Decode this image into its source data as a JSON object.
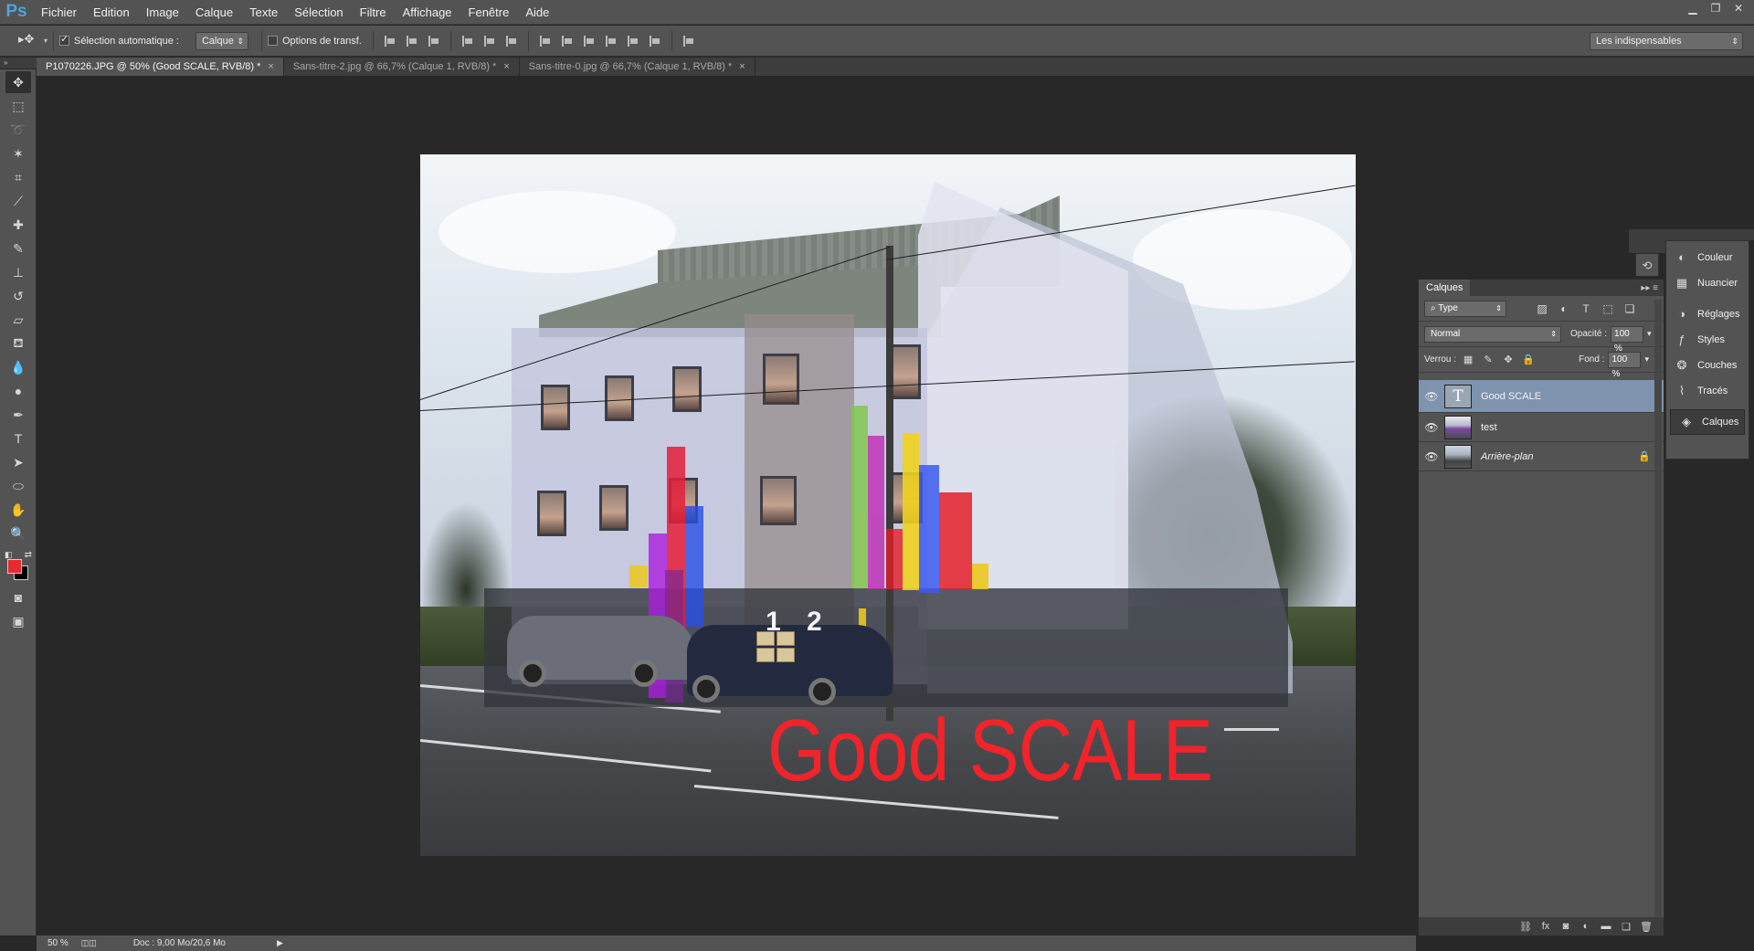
{
  "app": {
    "logo": "Ps"
  },
  "menu": [
    "Fichier",
    "Edition",
    "Image",
    "Calque",
    "Texte",
    "Sélection",
    "Filtre",
    "Affichage",
    "Fenêtre",
    "Aide"
  ],
  "window_controls": {
    "minimize": "▁",
    "restore": "❐",
    "close": "✕"
  },
  "options": {
    "auto_select_label": "Sélection automatique :",
    "auto_select_checked": true,
    "auto_select_target": "Calque",
    "transform_label": "Options de transf.",
    "transform_checked": false,
    "workspace": "Les indispensables"
  },
  "tabs": [
    {
      "label": "P1070226.JPG @ 50% (Good SCALE, RVB/8) *",
      "active": true
    },
    {
      "label": "Sans-titre-2.jpg @ 66,7% (Calque 1, RVB/8) *",
      "active": false
    },
    {
      "label": "Sans-titre-0.jpg @ 66,7% (Calque 1, RVB/8) *",
      "active": false
    }
  ],
  "tab_close": "×",
  "colors": {
    "foreground": "#e52b2b",
    "background": "#000000",
    "accent_selected_layer": "#7e93ad",
    "overlay_text": "#f0242a"
  },
  "canvas": {
    "overlay_text": "Good SCALE",
    "house_numbers": "1 2"
  },
  "status": {
    "zoom": "50 %",
    "doc": "Doc : 9,00 Mo/20,6 Mo"
  },
  "right_dock": {
    "items": [
      {
        "label": "Couleur",
        "icon": "color-wheel-icon",
        "glyph": "◐"
      },
      {
        "label": "Nuancier",
        "icon": "swatches-grid-icon",
        "glyph": "▦"
      },
      {
        "label": "Réglages",
        "icon": "adjustments-icon",
        "glyph": "◑"
      },
      {
        "label": "Styles",
        "icon": "fx-styles-icon",
        "glyph": "ƒ"
      },
      {
        "label": "Couches",
        "icon": "channels-icon",
        "glyph": "❂"
      },
      {
        "label": "Tracés",
        "icon": "paths-icon",
        "glyph": "⌇"
      },
      {
        "label": "Calques",
        "icon": "layers-icon",
        "glyph": "◈"
      }
    ]
  },
  "layers_panel": {
    "title": "Calques",
    "filter_type": "Type",
    "blend_mode": "Normal",
    "opacity_label": "Opacité :",
    "opacity": "100 %",
    "lock_label": "Verrou :",
    "fill_label": "Fond :",
    "fill": "100 %",
    "layers": [
      {
        "name": "Good SCALE",
        "kind": "text",
        "selected": true,
        "locked": false
      },
      {
        "name": "test",
        "kind": "image",
        "selected": false,
        "locked": false
      },
      {
        "name": "Arrière-plan",
        "kind": "background",
        "selected": false,
        "locked": true
      }
    ]
  }
}
